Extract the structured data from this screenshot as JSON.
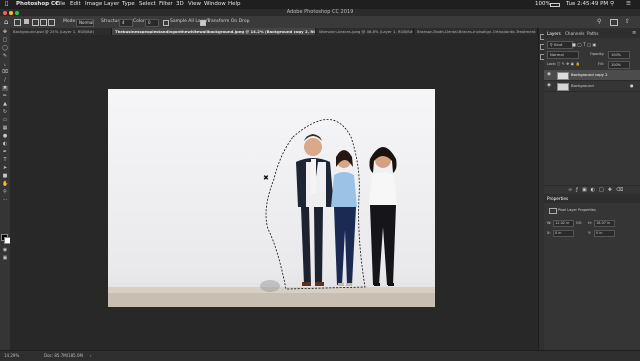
{
  "menubar": {
    "app": "Photoshop CC",
    "items": [
      "File",
      "Edit",
      "Image",
      "Layer",
      "Type",
      "Select",
      "Filter",
      "3D",
      "View",
      "Window",
      "Help"
    ],
    "battery": "100%",
    "clock": "Tue 2:45:49 PM"
  },
  "window_title": "Adobe Photoshop CC 2019",
  "options": {
    "mode_label": "Mode:",
    "mode_value": "Normal",
    "brightness_label": "Structure:",
    "brightness_value": "4",
    "color_label": "Color:",
    "color_value": "0",
    "sample_all": "Sample All Layers",
    "transform": "Transform On Drop"
  },
  "tabs": [
    "Background.psd @ 25% (Layer 1, RGB/8#)",
    "Thebusinesspeoplestandingonthewhitewallbackground.jpeg @ 14.2% (Background copy 2, RGB/8#)",
    "Womanin-braces.jpeg @ 46.8% (Layer 1, RGB/8#)",
    "Braeson-Tooth-Dental-Braces-Invisalign-Orthodontic-Treatment"
  ],
  "status": {
    "zoom": "14.29%",
    "doc": "Doc: 85.7M/185.0M"
  },
  "panel": {
    "tabs": [
      "Layers",
      "Channels",
      "Paths"
    ],
    "kind": "Kind",
    "blend": "Normal",
    "opacity_label": "Opacity:",
    "opacity": "100%",
    "lock_label": "Lock:",
    "fill_label": "Fill:",
    "fill": "100%",
    "layers": [
      "Background copy 2",
      "Background"
    ],
    "properties_title": "Properties",
    "properties_sub": "Pixel Layer Properties",
    "w_label": "W:",
    "w_value": "12.02 in",
    "h_label": "H:",
    "h_value": "16.07 in",
    "go_label": "GO",
    "x_label": "X:",
    "x_value": "0 in",
    "y_label": "Y:",
    "y_value": "0 in"
  }
}
